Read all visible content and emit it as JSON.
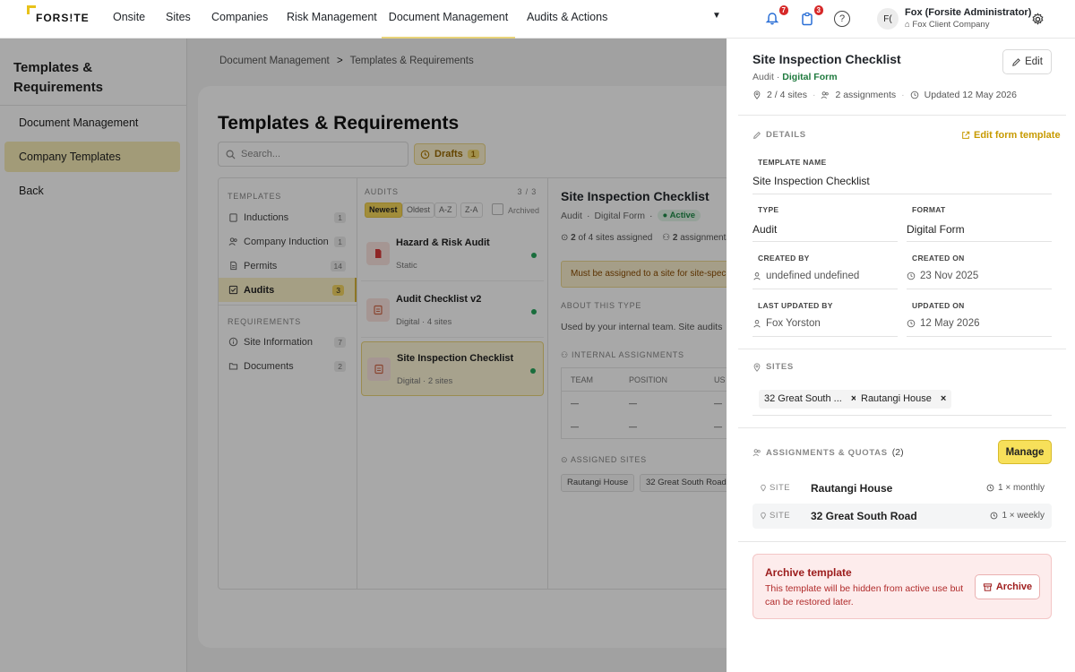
{
  "nav": {
    "logo": "FORS!TE",
    "items": [
      "Onsite",
      "Sites",
      "Companies",
      "Risk Management",
      "Document Management",
      "Audits & Actions"
    ],
    "active": "Document Management",
    "notifications_count": "7",
    "tasks_count": "3",
    "help_label": "?",
    "avatar_initials": "F(",
    "user_name": "Fox (Forsite Administrator)",
    "user_company": "Fox Client Company"
  },
  "sidebar": {
    "title": "Templates & Requirements",
    "items": [
      {
        "label": "Document Management",
        "active": false
      },
      {
        "label": "Company Templates",
        "active": true
      },
      {
        "label": "Back",
        "active": false
      }
    ]
  },
  "breadcrumb": {
    "parent": "Document Management",
    "separator": ">",
    "current": "Templates & Requirements"
  },
  "page": {
    "title": "Templates & Requirements",
    "search_placeholder": "Search...",
    "drafts_label": "Drafts",
    "drafts_count": "1"
  },
  "templates_col": {
    "heading": "TEMPLATES",
    "items": [
      {
        "label": "Inductions",
        "count": "1",
        "icon": "clipboard-icon"
      },
      {
        "label": "Company Induction",
        "count": "1",
        "icon": "users-icon"
      },
      {
        "label": "Permits",
        "count": "14",
        "icon": "document-icon"
      },
      {
        "label": "Audits",
        "count": "3",
        "icon": "checkbox-icon",
        "active": true
      }
    ],
    "req_heading": "REQUIREMENTS",
    "req_items": [
      {
        "label": "Site Information",
        "count": "7",
        "icon": "info-icon"
      },
      {
        "label": "Documents",
        "count": "2",
        "icon": "folder-icon"
      }
    ]
  },
  "audits_col": {
    "heading": "AUDITS",
    "count": "3 / 3",
    "sort": [
      "Newest",
      "Oldest",
      "A-Z",
      "Z-A"
    ],
    "archived_label": "Archived",
    "items": [
      {
        "title": "Hazard & Risk Audit",
        "sub": "Static",
        "icon": "pdf-icon"
      },
      {
        "title": "Audit Checklist v2",
        "sub": "Digital · 4 sites",
        "icon": "form-icon"
      },
      {
        "title": "Site Inspection Checklist",
        "sub": "Digital · 2 sites",
        "icon": "form-icon",
        "active": true
      }
    ]
  },
  "detail_col": {
    "title": "Site Inspection Checklist",
    "type": "Audit",
    "format": "Digital Form",
    "status": "Active",
    "sites_bold": "2",
    "sites_text": "of 4 sites assigned",
    "assign_bold": "2",
    "assign_text": "assignments",
    "warning": "Must be assigned to a site for site-specific",
    "about_heading": "ABOUT THIS TYPE",
    "about_text": "Used by your internal team. Site audits",
    "internal_heading": "INTERNAL ASSIGNMENTS",
    "table_cols": [
      "TEAM",
      "POSITION",
      "US"
    ],
    "dash": "—",
    "assigned_heading": "ASSIGNED SITES",
    "assigned_sites": [
      "Rautangi House",
      "32 Great South Road"
    ]
  },
  "drawer": {
    "title": "Site Inspection Checklist",
    "type": "Audit",
    "dot": "·",
    "format": "Digital Form",
    "sites_stat": "2 / 4 sites",
    "assignments_stat": "2 assignments",
    "updated_stat": "Updated 12 May 2026",
    "edit_label": "Edit",
    "details_heading": "DETAILS",
    "edit_form_label": "Edit form template",
    "fields": {
      "template_name_label": "TEMPLATE NAME",
      "template_name": "Site Inspection Checklist",
      "type_label": "TYPE",
      "type": "Audit",
      "format_label": "FORMAT",
      "format": "Digital Form",
      "created_by_label": "CREATED BY",
      "created_by": "undefined undefined",
      "created_on_label": "CREATED ON",
      "created_on": "23 Nov 2025",
      "last_updated_by_label": "LAST UPDATED BY",
      "last_updated_by": "Fox Yorston",
      "updated_on_label": "UPDATED ON",
      "updated_on": "12 May 2026"
    },
    "sites_heading": "SITES",
    "sites": [
      "32 Great South ...",
      "Rautangi House"
    ],
    "remove_glyph": "×",
    "assignments_heading": "ASSIGNMENTS & QUOTAS",
    "assignments_count": "(2)",
    "manage_label": "Manage",
    "assignments": [
      {
        "label": "SITE",
        "name": "Rautangi House",
        "freq": "1 × monthly"
      },
      {
        "label": "SITE",
        "name": "32 Great South Road",
        "freq": "1 × weekly"
      }
    ],
    "archive": {
      "title": "Archive template",
      "desc": "This template will be hidden from active use but can be restored later.",
      "button": "Archive"
    }
  }
}
